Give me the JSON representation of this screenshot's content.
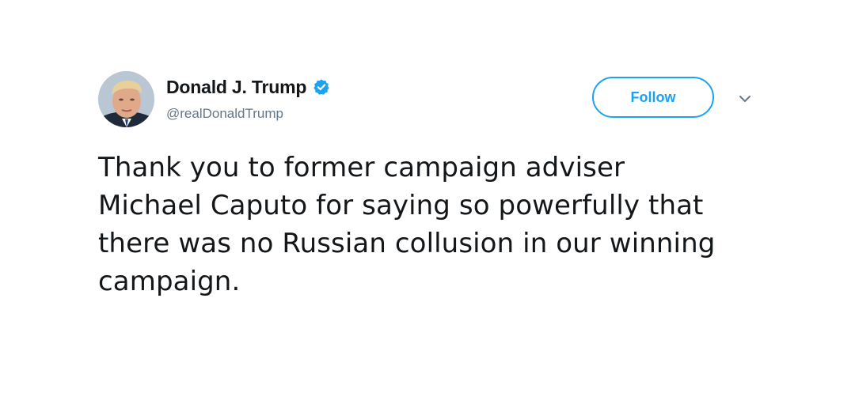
{
  "author": {
    "display_name": "Donald J. Trump",
    "handle": "@realDonaldTrump",
    "verified": true,
    "avatar_icon": "profile-photo"
  },
  "actions": {
    "follow_label": "Follow",
    "more_icon": "chevron-down-icon"
  },
  "tweet": {
    "lines": [
      "Thank you to former campaign adviser",
      "Michael Caputo for saying so powerfully that",
      "there was no Russian collusion in our winning",
      "campaign."
    ]
  },
  "colors": {
    "accent": "#1da1f2",
    "text": "#14171a",
    "muted": "#657786"
  }
}
